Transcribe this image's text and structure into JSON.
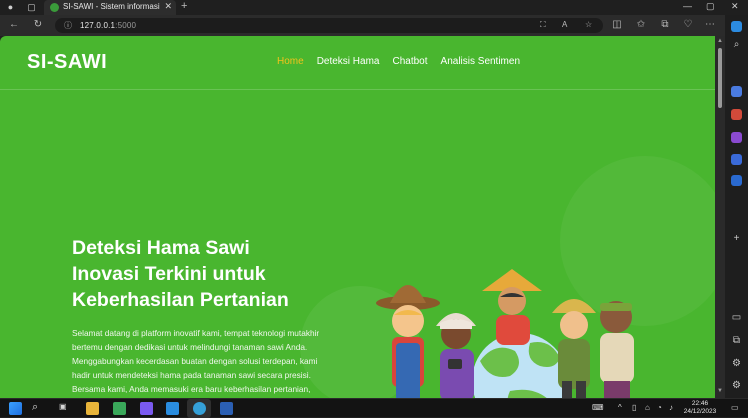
{
  "browser": {
    "tab": {
      "title": "SI-SAWI - Sistem informasi Deteksi Hama"
    },
    "address": {
      "host": "127.0.0.1",
      "port": ":5000"
    }
  },
  "page": {
    "brand": "SI-SAWI",
    "nav": [
      {
        "label": "Home",
        "active": true
      },
      {
        "label": "Deteksi Hama",
        "active": false
      },
      {
        "label": "Chatbot",
        "active": false
      },
      {
        "label": "Analisis Sentimen",
        "active": false
      }
    ],
    "hero": {
      "title_lines": [
        "Deteksi Hama Sawi",
        "Inovasi Terkini untuk",
        "Keberhasilan Pertanian"
      ],
      "paragraph_lines": [
        "Selamat datang di platform inovatif kami, tempat teknologi mutakhir",
        "bertemu dengan dedikasi untuk melindungi tanaman sawi Anda.",
        "Menggabungkan kecerdasan buatan dengan solusi terdepan, kami",
        "hadir untuk mendeteksi hama pada tanaman sawi secara presisi.",
        "Bersama kami, Anda memasuki era baru keberhasilan pertanian,"
      ]
    },
    "colors": {
      "background": "#49b62f",
      "nav_active": "#f2c21b",
      "text": "#ffffff"
    }
  },
  "taskbar": {
    "time": "22:46",
    "date": "24/12/2023"
  }
}
